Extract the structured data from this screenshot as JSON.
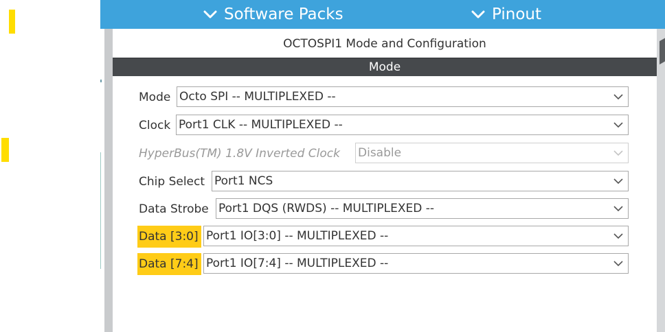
{
  "topbar": {
    "software_packs": "Software Packs",
    "pinout": "Pinout"
  },
  "panel": {
    "title": "OCTOSPI1 Mode and Configuration",
    "section_header": "Mode"
  },
  "fields": [
    {
      "label": "Mode",
      "value": "Octo SPI -- MULTIPLEXED --",
      "disabled": false,
      "highlighted": false
    },
    {
      "label": "Clock",
      "value": "Port1 CLK -- MULTIPLEXED --",
      "disabled": false,
      "highlighted": false
    },
    {
      "label": "HyperBus(TM) 1.8V Inverted Clock",
      "value": "Disable",
      "disabled": true,
      "highlighted": false
    },
    {
      "label": "Chip Select",
      "value": "Port1 NCS",
      "disabled": false,
      "highlighted": false
    },
    {
      "label": "Data Strobe",
      "value": "Port1 DQS (RWDS) -- MULTIPLEXED --",
      "disabled": false,
      "highlighted": false
    },
    {
      "label": "Data [3:0]",
      "value": "Port1 IO[3:0] -- MULTIPLEXED --",
      "disabled": false,
      "highlighted": true
    },
    {
      "label": "Data [7:4]",
      "value": "Port1 IO[7:4] -- MULTIPLEXED --",
      "disabled": false,
      "highlighted": true
    }
  ],
  "colors": {
    "topbar": "#3ea3dc",
    "section_header": "#46494c",
    "highlight": "#ffcc17"
  },
  "icons": {
    "topbar_chevron": "chevron-down-icon",
    "select_chevron": "chevron-down-icon"
  }
}
